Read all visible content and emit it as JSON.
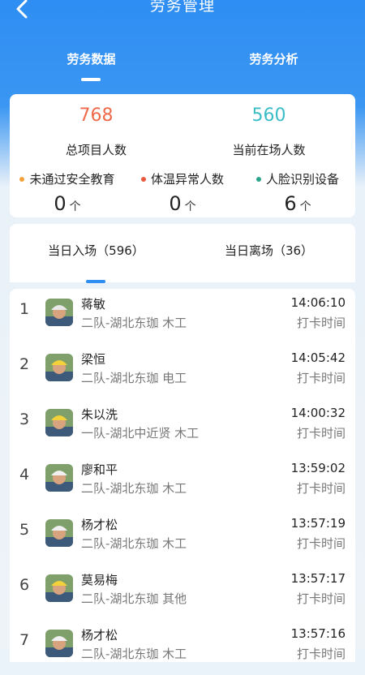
{
  "header": {
    "title": "劳务管理"
  },
  "tabs": [
    "劳务数据",
    "劳务分析"
  ],
  "stats": {
    "total": {
      "value": "768",
      "label": "总项目人数"
    },
    "onsite": {
      "value": "560",
      "label": "当前在场人数"
    },
    "mini": [
      {
        "label": "未通过安全教育",
        "value": "0",
        "unit": "个",
        "dot_color": "#f3a23b"
      },
      {
        "label": "体温异常人数",
        "value": "0",
        "unit": "个",
        "dot_color": "#e9593e"
      },
      {
        "label": "人脸识别设备",
        "value": "6",
        "unit": "个",
        "dot_color": "#2aa58a"
      }
    ]
  },
  "sub_tabs": [
    "当日入场（596）",
    "当日离场（36）"
  ],
  "records": [
    {
      "index": "1",
      "name": "蒋敏",
      "team": "二队-湖北东珈 木工",
      "time": "14:06:10",
      "time_label": "打卡时间",
      "helmet": "#e8e8e8"
    },
    {
      "index": "2",
      "name": "梁恒",
      "team": "二队-湖北东珈 电工",
      "time": "14:05:42",
      "time_label": "打卡时间",
      "helmet": "#f2d13a"
    },
    {
      "index": "3",
      "name": "朱以洗",
      "team": "一队-湖北中近贤 木工",
      "time": "14:00:32",
      "time_label": "打卡时间",
      "helmet": "#f2d13a"
    },
    {
      "index": "4",
      "name": "廖和平",
      "team": "二队-湖北东珈 木工",
      "time": "13:59:02",
      "time_label": "打卡时间",
      "helmet": "#f0f0f0"
    },
    {
      "index": "5",
      "name": "杨才松",
      "team": "二队-湖北东珈 木工",
      "time": "13:57:19",
      "time_label": "打卡时间",
      "helmet": "#f0f0f0"
    },
    {
      "index": "6",
      "name": "莫易梅",
      "team": "二队-湖北东珈 其他",
      "time": "13:57:17",
      "time_label": "打卡时间",
      "helmet": "#f2d13a"
    },
    {
      "index": "7",
      "name": "杨才松",
      "team": "二队-湖北东珈 木工",
      "time": "13:57:16",
      "time_label": "打卡时间",
      "helmet": "#f0f0f0"
    }
  ]
}
